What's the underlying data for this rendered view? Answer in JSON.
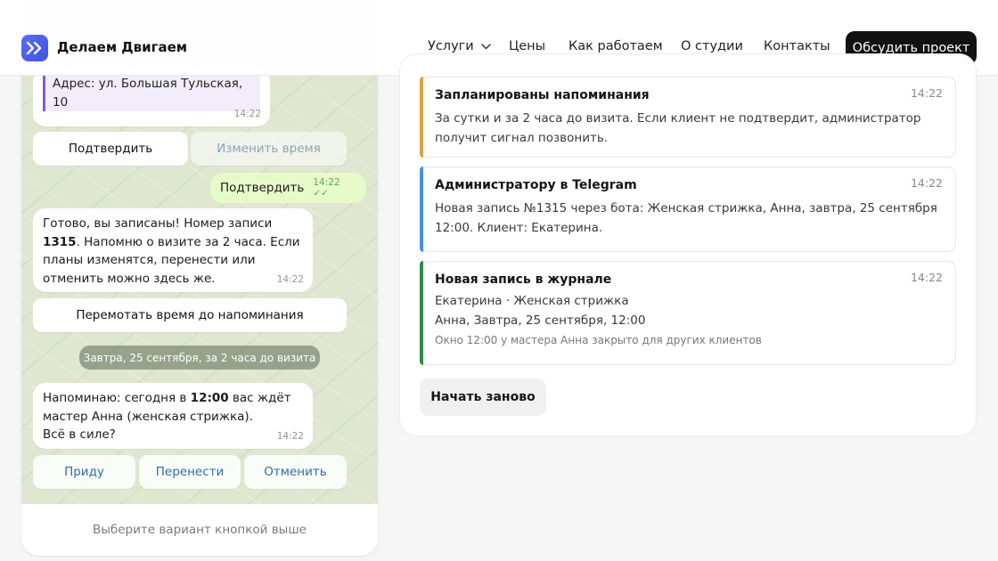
{
  "header": {
    "brand": "Делаем Двигаем",
    "nav": {
      "services": "Услуги",
      "prices": "Цены",
      "how_we_work": "Как работаем",
      "about": "О студии",
      "contacts": "Контакты"
    },
    "cta": "Обсудить проект"
  },
  "chat": {
    "address_line": "Адрес: ул. Большая Тульская, 10",
    "address_time": "14:22",
    "keyboard1": {
      "confirm": "Подтвердить",
      "change_time": "Изменить время"
    },
    "user_reply": {
      "text": "Подтвердить",
      "time": "14:22 ✓✓"
    },
    "booked": {
      "pre": "Готово, вы записаны! Номер записи ",
      "number": "1315",
      "post": ". Напомню о визите за 2 часа. Если планы изменятся, перенести или отменить можно здесь же.",
      "time": "14:22"
    },
    "fast_forward": "Перемотать время до напоминания",
    "date_pill": "Завтра, 25 сентября, за 2 часа до визита",
    "reminder": {
      "pre": "Напоминаю: сегодня в ",
      "time_bold": "12:00",
      "mid": " вас ждёт мастер Анна (женская стрижка).",
      "line2": "Всё в силе?",
      "time": "14:22"
    },
    "keyboard2": {
      "come": "Приду",
      "reschedule": "Перенести",
      "cancel": "Отменить"
    },
    "footer_hint": "Выберите вариант кнопкой выше"
  },
  "events": [
    {
      "title": "Запланированы напоминания",
      "time": "14:22",
      "text": "За сутки и за 2 часа до визита. Если клиент не подтвердит, администратор получит сигнал позвонить.",
      "accent": "#d9a441"
    },
    {
      "title": "Администратору в Telegram",
      "time": "14:22",
      "text": "Новая запись №1315 через бота: Женская стрижка, Анна, завтра, 25 сентября 12:00. Клиент: Екатерина.",
      "accent": "#4a90d9"
    },
    {
      "title": "Новая запись в журнале",
      "time": "14:22",
      "line1": "Екатерина · Женская стрижка",
      "line2": "Анна, Завтра, 25 сентября, 12:00",
      "note": "Окно 12:00 у мастера Анна закрыто для других клиентов",
      "accent": "#2f8a4a"
    }
  ],
  "restart": "Начать заново",
  "colors": {
    "brand": "#4a5cf0",
    "cta_bg": "#111111",
    "chat_bg": "#dfe7d0",
    "out_bubble": "#e6fbc9"
  }
}
